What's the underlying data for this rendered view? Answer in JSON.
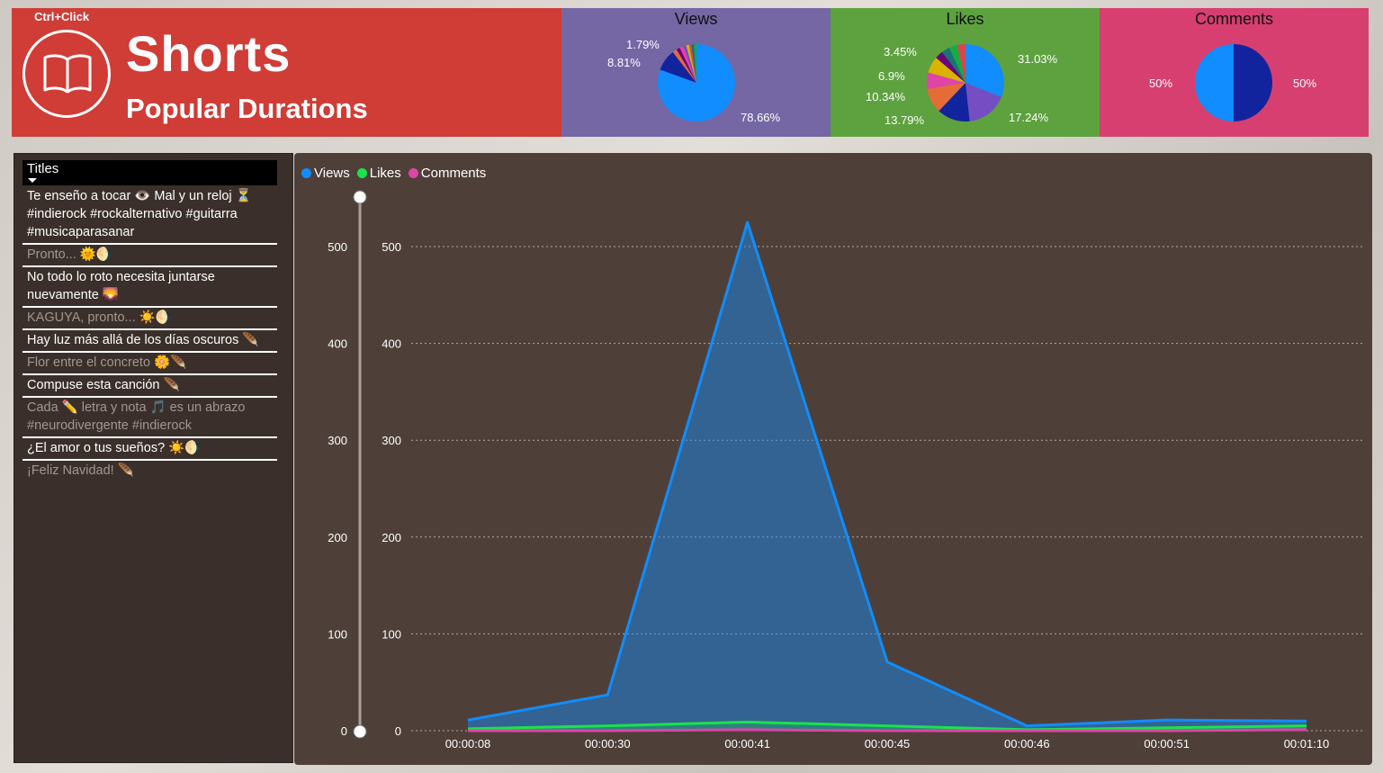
{
  "header": {
    "hint": "Ctrl+Click",
    "title": "Shorts",
    "subtitle": "Popular Durations",
    "icon": "book-icon"
  },
  "cards": {
    "views": {
      "title": "Views",
      "labels": [
        "1.79%",
        "8.81%",
        "78.66%"
      ],
      "slices": [
        {
          "value": 78.66,
          "color": "#118dff"
        },
        {
          "value": 8.81,
          "color": "#12239e"
        },
        {
          "value": 1.79,
          "color": "#e66c37"
        },
        {
          "value": 1.5,
          "color": "#6b007b"
        },
        {
          "value": 1.5,
          "color": "#e044a7"
        },
        {
          "value": 1.2,
          "color": "#744ec2"
        },
        {
          "value": 1.2,
          "color": "#d9b300"
        },
        {
          "value": 1.0,
          "color": "#d64550"
        },
        {
          "value": 1.0,
          "color": "#197278"
        },
        {
          "value": 1.0,
          "color": "#1aab40"
        }
      ]
    },
    "likes": {
      "title": "Likes",
      "labels": [
        "3.45%",
        "6.9%",
        "10.34%",
        "13.79%",
        "31.03%",
        "17.24%"
      ],
      "slices": [
        {
          "value": 31.03,
          "color": "#118dff"
        },
        {
          "value": 17.24,
          "color": "#744ec2"
        },
        {
          "value": 13.79,
          "color": "#12239e"
        },
        {
          "value": 10.34,
          "color": "#e66c37"
        },
        {
          "value": 6.9,
          "color": "#e044a7"
        },
        {
          "value": 6.9,
          "color": "#d9b300"
        },
        {
          "value": 3.45,
          "color": "#6b007b"
        },
        {
          "value": 3.45,
          "color": "#197278"
        },
        {
          "value": 3.45,
          "color": "#1aab40"
        },
        {
          "value": 3.45,
          "color": "#d64550"
        }
      ]
    },
    "comments": {
      "title": "Comments",
      "labels": [
        "50%",
        "50%"
      ],
      "slices": [
        {
          "value": 50,
          "color": "#12239e"
        },
        {
          "value": 50,
          "color": "#118dff"
        }
      ]
    }
  },
  "titles_panel": {
    "header": "Titles",
    "items": [
      {
        "text": "Te enseño a tocar 👁️ Mal y un reloj ⏳ #indierock #rockalternativo #guitarra #musicaparasanar",
        "active": true
      },
      {
        "text": "Pronto... 🌞🌖",
        "active": false
      },
      {
        "text": "No todo lo roto necesita juntarse nuevamente 🌄",
        "active": true
      },
      {
        "text": "KAGUYA, pronto... ☀️🌖",
        "active": false
      },
      {
        "text": "Hay luz más allá de los días oscuros 🪶",
        "active": true
      },
      {
        "text": "Flor entre el concreto 🌼🪶",
        "active": false
      },
      {
        "text": "Compuse esta canción 🪶",
        "active": true
      },
      {
        "text": "Cada ✏️ letra y nota 🎵 es un abrazo #neurodivergente #indierock",
        "active": false
      },
      {
        "text": "¿El amor o tus sueños? ☀️🌖",
        "active": true
      },
      {
        "text": "¡Feliz Navidad! 🪶",
        "active": false
      }
    ]
  },
  "chart_data": {
    "type": "area",
    "x": [
      "00:00:08",
      "00:00:30",
      "00:00:41",
      "00:00:45",
      "00:00:46",
      "00:00:51",
      "00:01:10"
    ],
    "series": [
      {
        "name": "Views",
        "color": "#118dff",
        "values": [
          11,
          37,
          525,
          71,
          5,
          11,
          10
        ]
      },
      {
        "name": "Likes",
        "color": "#19e34a",
        "values": [
          2,
          5,
          9,
          5,
          1,
          3,
          5
        ]
      },
      {
        "name": "Comments",
        "color": "#e044a7",
        "values": [
          0,
          0,
          1,
          0,
          0,
          0,
          1
        ]
      }
    ],
    "yticks": [
      "0",
      "100",
      "200",
      "300",
      "400",
      "500"
    ],
    "ylim": [
      0,
      560
    ],
    "grid": true,
    "legend": "top-left"
  }
}
